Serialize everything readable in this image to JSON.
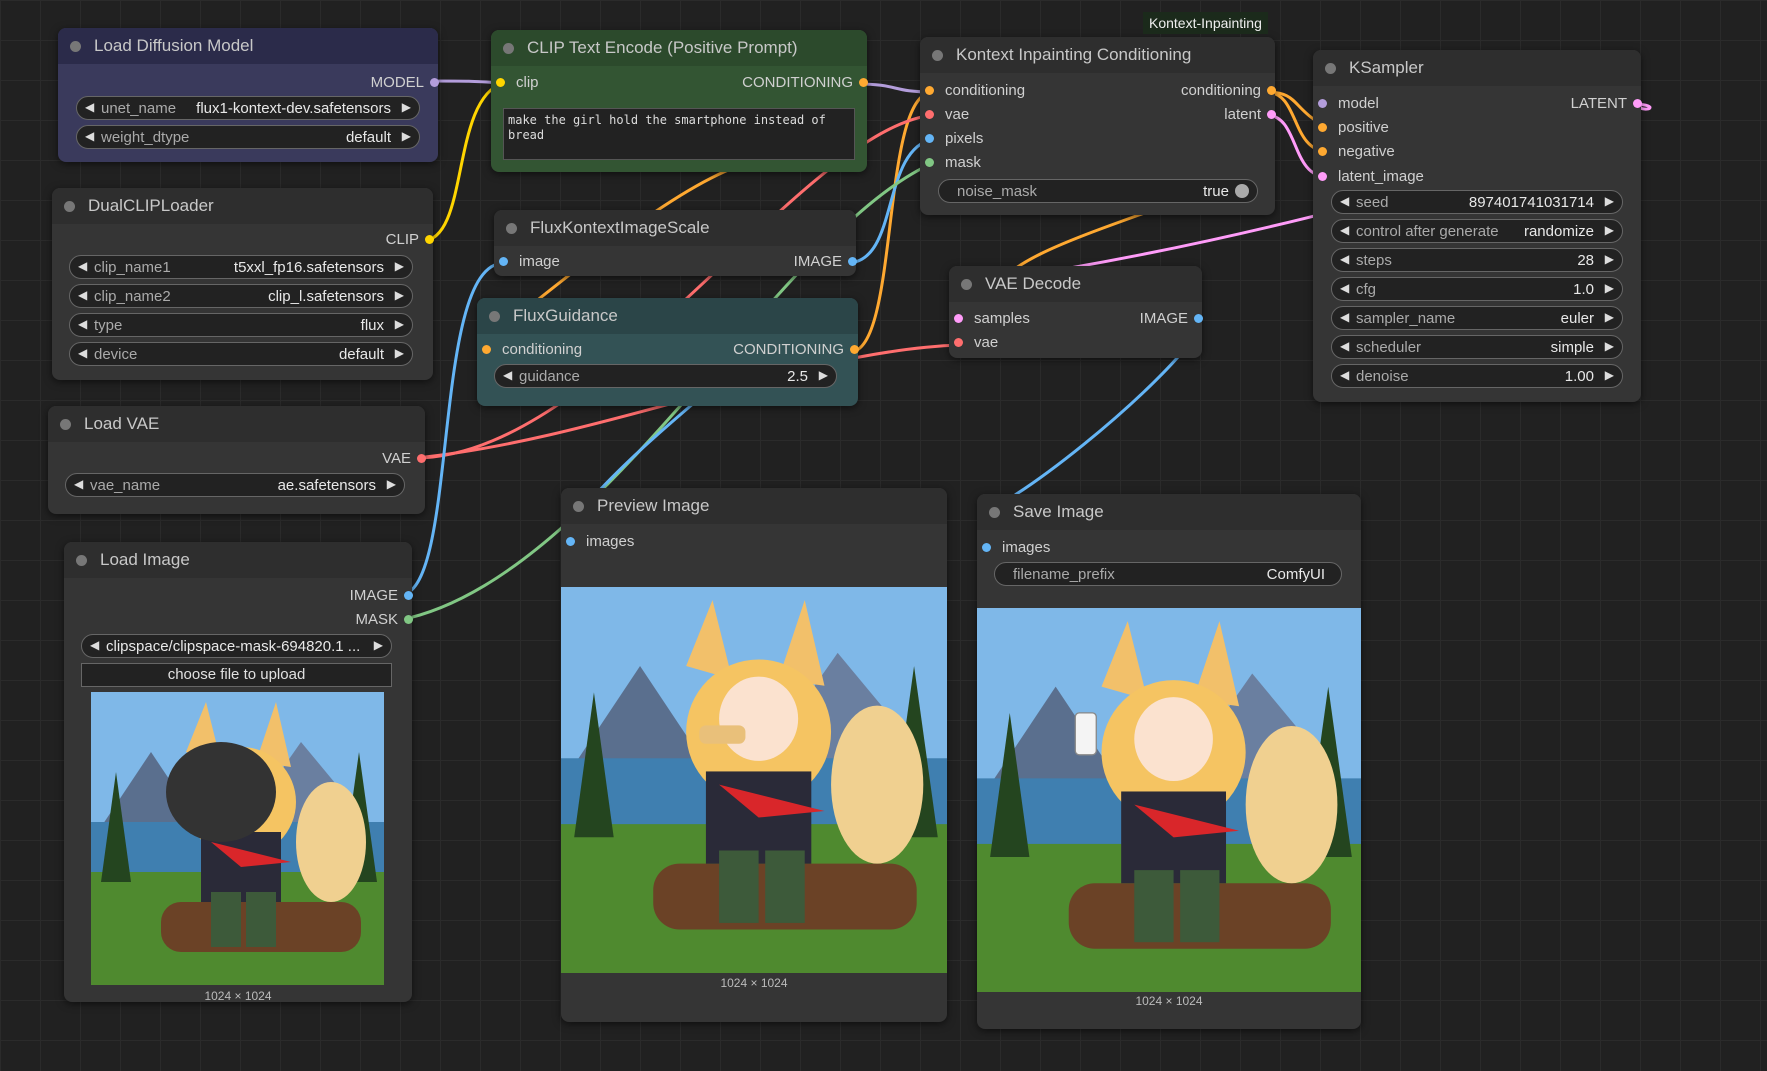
{
  "colors": {
    "model": "#b39ddb",
    "clip": "#ffd500",
    "conditioning": "#ffa931",
    "latent": "#ff9cf9",
    "vae": "#ff6e6e",
    "image": "#64b5f6",
    "mask": "#81c784"
  },
  "tooltip": "Kontext-Inpainting",
  "load_diffusion": {
    "title": "Load Diffusion Model",
    "out_model": "MODEL",
    "unet_label": "unet_name",
    "unet_value": "flux1-kontext-dev.safetensors",
    "dtype_label": "weight_dtype",
    "dtype_value": "default"
  },
  "clip_text": {
    "title": "CLIP Text Encode (Positive Prompt)",
    "in_clip": "clip",
    "out_cond": "CONDITIONING",
    "prompt": "make the girl hold the smartphone instead of bread"
  },
  "kontext": {
    "title": "Kontext Inpainting Conditioning",
    "in_cond": "conditioning",
    "in_vae": "vae",
    "in_pixels": "pixels",
    "in_mask": "mask",
    "out_cond": "conditioning",
    "out_latent": "latent",
    "noise_label": "noise_mask",
    "noise_value": "true"
  },
  "ksampler": {
    "title": "KSampler",
    "in_model": "model",
    "in_positive": "positive",
    "in_negative": "negative",
    "in_latent": "latent_image",
    "out_latent": "LATENT",
    "widgets": [
      {
        "label": "seed",
        "value": "897401741031714"
      },
      {
        "label": "control after generate",
        "value": "randomize"
      },
      {
        "label": "steps",
        "value": "28"
      },
      {
        "label": "cfg",
        "value": "1.0"
      },
      {
        "label": "sampler_name",
        "value": "euler"
      },
      {
        "label": "scheduler",
        "value": "simple"
      },
      {
        "label": "denoise",
        "value": "1.00"
      }
    ]
  },
  "dualclip": {
    "title": "DualCLIPLoader",
    "out_clip": "CLIP",
    "widgets": [
      {
        "label": "clip_name1",
        "value": "t5xxl_fp16.safetensors"
      },
      {
        "label": "clip_name2",
        "value": "clip_l.safetensors"
      },
      {
        "label": "type",
        "value": "flux"
      },
      {
        "label": "device",
        "value": "default"
      }
    ]
  },
  "scale": {
    "title": "FluxKontextImageScale",
    "in_image": "image",
    "out_image": "IMAGE"
  },
  "guidance": {
    "title": "FluxGuidance",
    "in_cond": "conditioning",
    "out_cond": "CONDITIONING",
    "g_label": "guidance",
    "g_value": "2.5"
  },
  "vaedecode": {
    "title": "VAE Decode",
    "in_samples": "samples",
    "in_vae": "vae",
    "out_image": "IMAGE"
  },
  "loadvae": {
    "title": "Load VAE",
    "out_vae": "VAE",
    "vae_label": "vae_name",
    "vae_value": "ae.safetensors"
  },
  "loadimage": {
    "title": "Load Image",
    "out_image": "IMAGE",
    "out_mask": "MASK",
    "file_value": "clipspace/clipspace-mask-694820.1 ...",
    "upload_label": "choose file to upload",
    "size": "1024 × 1024"
  },
  "preview": {
    "title": "Preview Image",
    "in_images": "images",
    "size": "1024 × 1024"
  },
  "save": {
    "title": "Save Image",
    "in_images": "images",
    "prefix_label": "filename_prefix",
    "prefix_value": "ComfyUI",
    "size": "1024 × 1024"
  }
}
